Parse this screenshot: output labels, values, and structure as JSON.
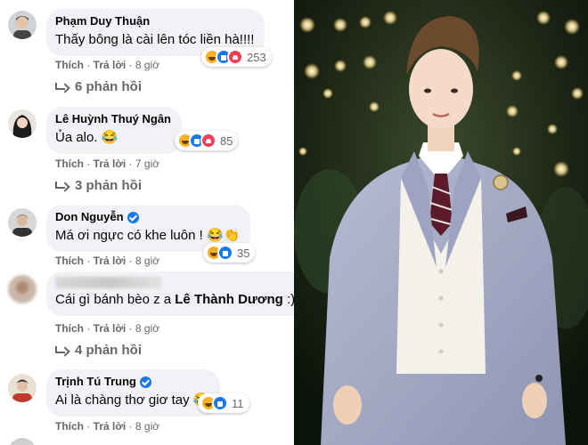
{
  "comments": [
    {
      "author": "Phạm Duy Thuận",
      "verified": false,
      "text": "Thấy bông là cài lên tóc liền hà!!!!",
      "reaction_count": "253",
      "like": "Thích",
      "reply": "Trả lời",
      "time": "8 giờ",
      "replies": "6 phản hồi"
    },
    {
      "author": "Lê Huỳnh Thuý Ngân",
      "verified": false,
      "text": "Ủa alo. 😂",
      "reaction_count": "85",
      "like": "Thích",
      "reply": "Trả lời",
      "time": "7 giờ",
      "replies": "3 phản hồi"
    },
    {
      "author": "Don Nguyễn",
      "verified": true,
      "text": "Má ơi ngực có khe luôn ! 😂👏",
      "reaction_count": "35",
      "like": "Thích",
      "reply": "Trả lời",
      "time": "8 giờ",
      "replies": ""
    },
    {
      "author": "",
      "author_hidden": true,
      "verified": false,
      "text_prefix": "Cái gì bánh bèo z a ",
      "mention": "Lê Thành Dương",
      "text_suffix": " :)",
      "reaction_count": "",
      "like": "Thích",
      "reply": "Trả lời",
      "time": "8 giờ",
      "replies": "4 phản hồi"
    },
    {
      "author": "Trịnh Tú Trung",
      "verified": true,
      "text": "Ai là chàng thơ giơ tay 😂",
      "reaction_count": "11",
      "like": "Thích",
      "reply": "Trả lời",
      "time": "8 giờ",
      "replies": ""
    }
  ],
  "icons": {
    "reaction_haha": "haha-reaction-icon",
    "reaction_like": "like-reaction-icon",
    "reaction_love": "love-reaction-icon",
    "verified": "verified-badge-icon",
    "reply_arrow": "reply-arrow-icon"
  },
  "colors": {
    "bubble": "#f0f2f5",
    "meta": "#65676b",
    "verified": "#1877f2",
    "suit": "#a8aec8"
  }
}
